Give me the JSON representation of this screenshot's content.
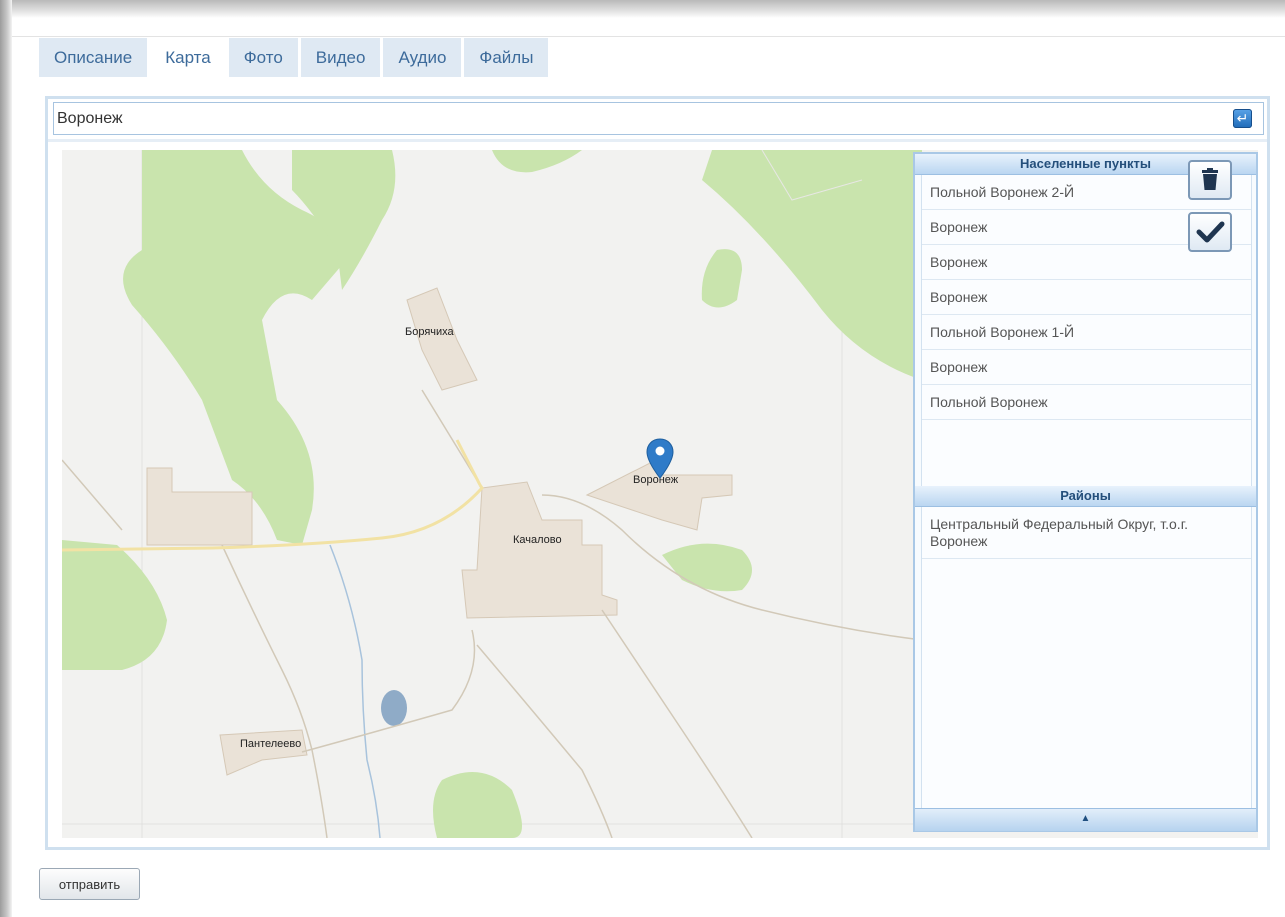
{
  "tabs": [
    {
      "label": "Описание"
    },
    {
      "label": "Карта"
    },
    {
      "label": "Фото"
    },
    {
      "label": "Видео"
    },
    {
      "label": "Аудио"
    },
    {
      "label": "Файлы"
    }
  ],
  "active_tab": "Карта",
  "search": {
    "value": "Воронеж"
  },
  "map": {
    "labels": {
      "boryachikha": "Борячиха",
      "voronezh": "Воронеж",
      "kachalovo": "Качалово",
      "panteleevo": "Пантелеево"
    }
  },
  "settlements": {
    "title": "Населенные пункты",
    "items": [
      "Польной Воронеж 2-Й",
      "Воронеж",
      "Воронеж",
      "Воронеж",
      "Польной Воронеж 1-Й",
      "Воронеж",
      "Польной Воронеж"
    ]
  },
  "districts": {
    "title": "Районы",
    "items": [
      "Центральный Федеральный Округ, т.о.г. Воронеж"
    ]
  },
  "icons": {
    "enter": "enter-icon",
    "delete": "trash-icon",
    "confirm": "check-icon",
    "marker": "map-marker-icon",
    "collapse": "triangle-up-icon"
  },
  "colors": {
    "accent": "#3d6b9b",
    "marker": "#2f7bc8",
    "forest": "#c9e4ad"
  },
  "submit": {
    "label": "отправить"
  }
}
